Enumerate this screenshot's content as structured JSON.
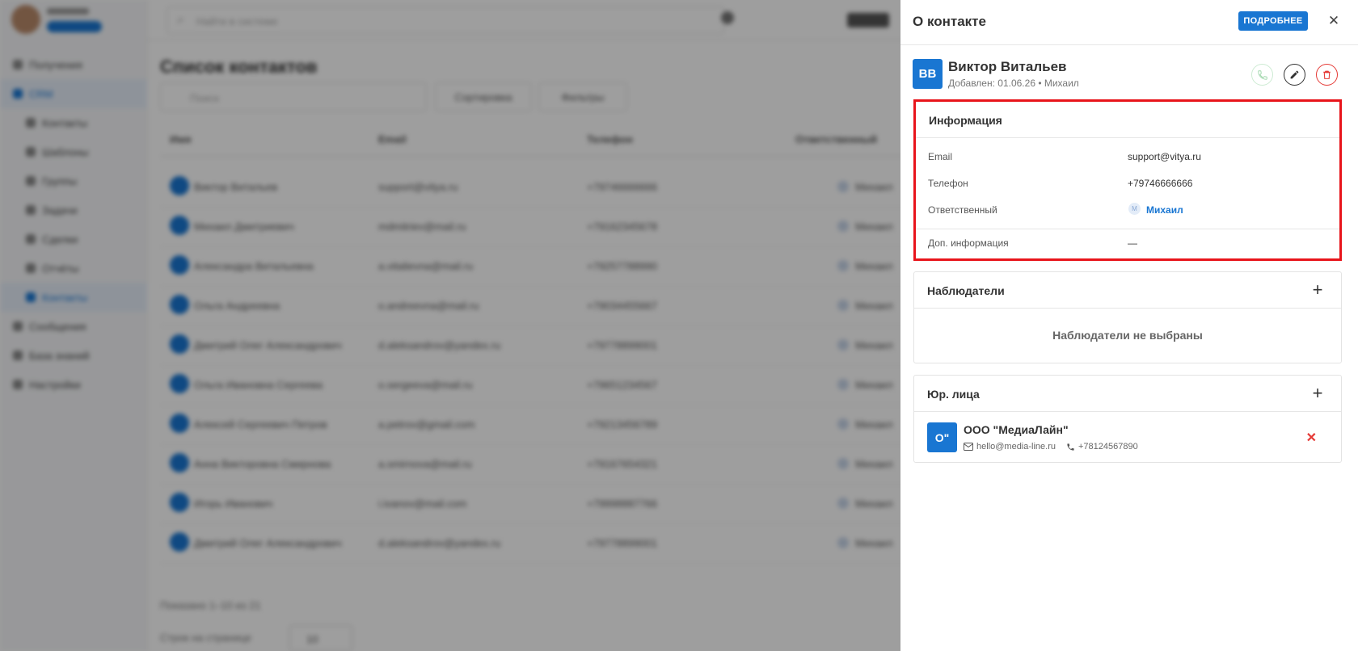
{
  "background": {
    "search_placeholder": "Найти в системе",
    "page_title": "Список контактов",
    "filter_placeholder": "Поиск",
    "filter_buttons": [
      "Сортировка",
      "Фильтры"
    ],
    "table_headers": [
      "Имя",
      "Email",
      "Телефон",
      "Ответственный"
    ],
    "sidebar_items": [
      "Получения",
      "CRM",
      "Контакты",
      "Шаблоны",
      "Группы",
      "Задачи",
      "Сделки",
      "Отчёты",
      "Контакты",
      "Сообщения",
      "База знаний",
      "Настройки"
    ],
    "pagination": {
      "summary": "Показано 1–10 из 21",
      "rows_label": "Строк на странице",
      "rows_value": "10"
    },
    "rows": [
      {
        "name": "Виктор Витальев",
        "email": "support@vitya.ru",
        "phone": "+79746666666",
        "owner": "Михаил"
      },
      {
        "name": "Михаил Дмитриевич",
        "email": "mdmitriev@mail.ru",
        "phone": "+79162345678",
        "owner": "Михаил"
      },
      {
        "name": "Александра Витальевна",
        "email": "a.vitalievna@mail.ru",
        "phone": "+79257788990",
        "owner": "Михаил"
      },
      {
        "name": "Ольга Андреевна",
        "email": "o.andreevna@mail.ru",
        "phone": "+79034455667",
        "owner": "Михаил"
      },
      {
        "name": "Дмитрий Олег Александрович",
        "email": "d.aleksandrov@yandex.ru",
        "phone": "+79778899001",
        "owner": "Михаил"
      },
      {
        "name": "Ольга Ивановна Сергеева",
        "email": "o.sergeeva@mail.ru",
        "phone": "+79651234567",
        "owner": "Михаил"
      },
      {
        "name": "Алексей Сергеевич Петров",
        "email": "a.petrov@gmail.com",
        "phone": "+79213456789",
        "owner": "Михаил"
      },
      {
        "name": "Анна Викторовна Смирнова",
        "email": "a.smirnova@mail.ru",
        "phone": "+79167654321",
        "owner": "Михаил"
      },
      {
        "name": "Игорь Иванович",
        "email": "i.ivanov@mail.com",
        "phone": "+79998887766",
        "owner": "Михаил"
      },
      {
        "name": "Дмитрий Олег Александрович",
        "email": "d.aleksandrov@yandex.ru",
        "phone": "+79778899001",
        "owner": "Михаил"
      }
    ]
  },
  "panel": {
    "title": "О контакте",
    "more_label": "ПОДРОБНЕЕ",
    "close_glyph": "✕",
    "contact": {
      "initials": "ВВ",
      "name": "Виктор Витальев",
      "subtitle": "Добавлен: 01.06.26 • Михаил"
    },
    "info": {
      "title": "Информация",
      "rows": [
        {
          "label": "Email",
          "value": "support@vitya.ru"
        },
        {
          "label": "Телефон",
          "value": "+79746666666"
        },
        {
          "label": "Ответственный",
          "value": "Михаил",
          "avatar": "М"
        },
        {
          "label": "Доп. информация",
          "value": "—"
        }
      ]
    },
    "observers": {
      "title": "Наблюдатели",
      "add_glyph": "+",
      "empty_text": "Наблюдатели не выбраны"
    },
    "legal": {
      "title": "Юр. лица",
      "add_glyph": "+",
      "org": {
        "initials": "О\"",
        "name": "ООО \"МедиаЛайн\"",
        "email": "hello@media-line.ru",
        "phone": "+78124567890",
        "delete_glyph": "✕"
      }
    }
  },
  "colors": {
    "accent": "#1976d2",
    "danger": "#e53935",
    "highlight": "#e8141b"
  }
}
